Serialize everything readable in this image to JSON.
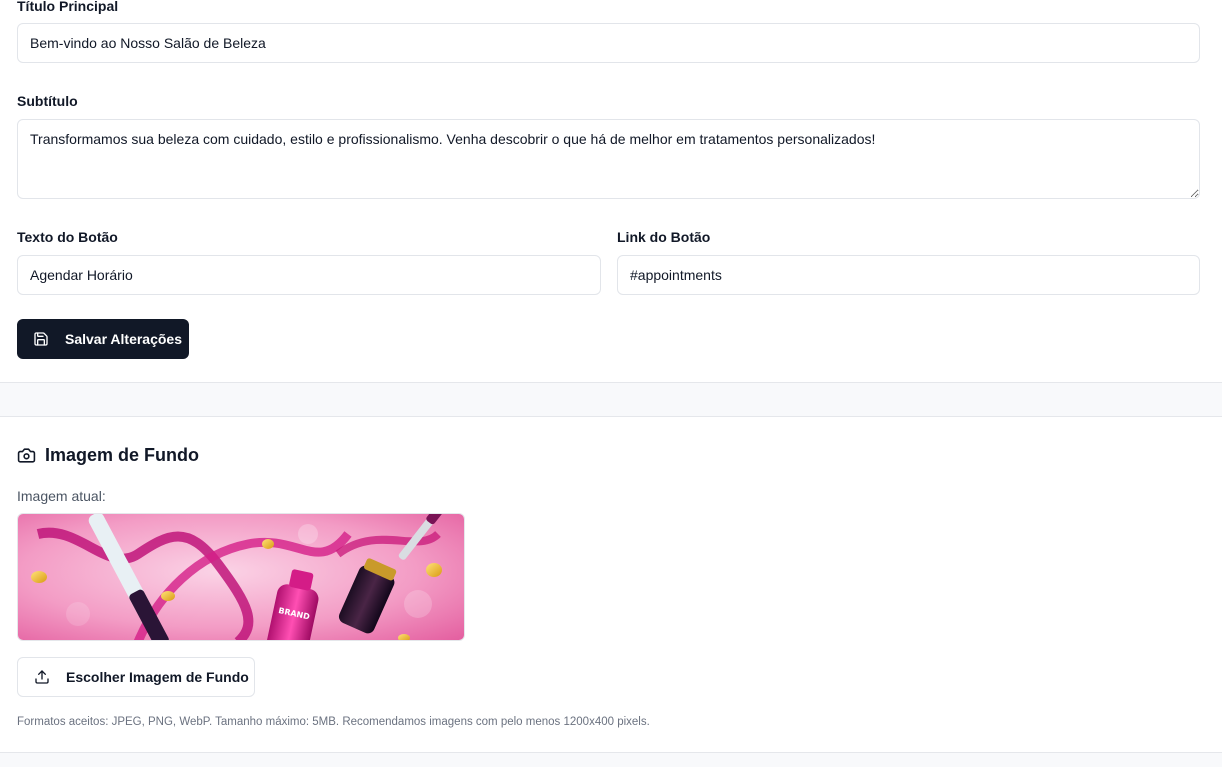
{
  "hero_form": {
    "title_label": "Título Principal",
    "title_value": "Bem-vindo ao Nosso Salão de Beleza",
    "subtitle_label": "Subtítulo",
    "subtitle_value": "Transformamos sua beleza com cuidado, estilo e profissionalismo. Venha descobrir o que há de melhor em tratamentos personalizados!",
    "button_text_label": "Texto do Botão",
    "button_text_value": "Agendar Horário",
    "button_link_label": "Link do Botão",
    "button_link_value": "#appointments",
    "save_button_label": "Salvar Alterações",
    "save_icon": "save-icon"
  },
  "background_section": {
    "title": "Imagem de Fundo",
    "title_icon": "camera-icon",
    "current_image_label": "Imagem atual:",
    "upload_button_label": "Escolher Imagem de Fundo",
    "upload_icon": "upload-icon",
    "help_text": "Formatos aceitos: JPEG, PNG, WebP. Tamanho máximo: 5MB. Recomendamos imagens com pelo menos 1200x400 pixels."
  },
  "colors": {
    "primary_button": "#111827",
    "page_background": "#f8f9fb",
    "border": "#e2e5ea",
    "preview_pink": "#e8559a"
  }
}
